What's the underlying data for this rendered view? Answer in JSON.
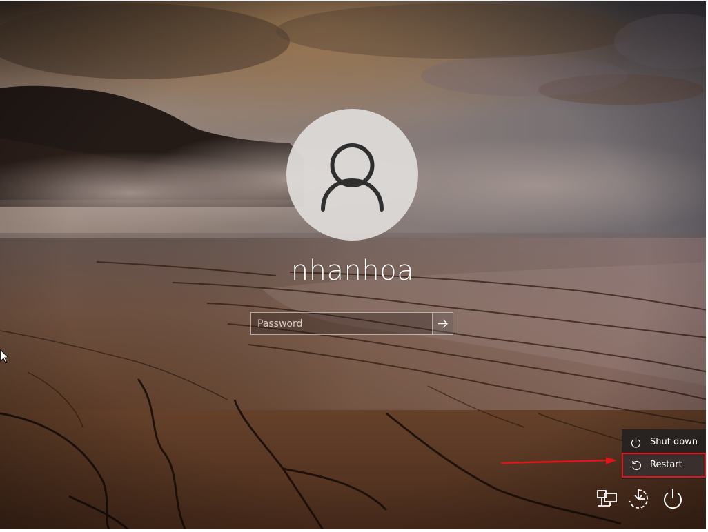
{
  "login": {
    "username": "nhanhoa",
    "password_placeholder": "Password"
  },
  "power_menu": {
    "items": [
      {
        "label": "Shut down",
        "icon": "power-icon"
      },
      {
        "label": "Restart",
        "icon": "restart-icon",
        "highlighted": true
      }
    ]
  },
  "tray": {
    "icons": [
      "network-icon",
      "ease-of-access-icon",
      "power-icon"
    ]
  },
  "colors": {
    "highlight_border": "#e0141b",
    "annotation_arrow": "#e0141b",
    "menu_background": "#262221",
    "text": "#ffffff"
  }
}
